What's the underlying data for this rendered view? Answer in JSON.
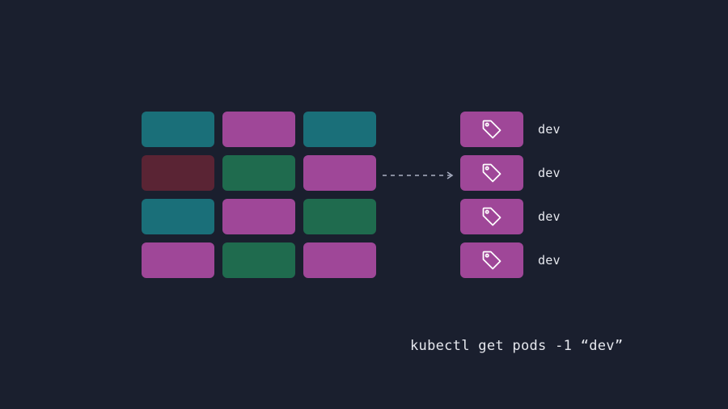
{
  "grid": {
    "cols": 3,
    "rows": 4,
    "colors": [
      [
        "teal",
        "magenta",
        "teal"
      ],
      [
        "maroon",
        "green",
        "magenta"
      ],
      [
        "teal",
        "magenta",
        "green"
      ],
      [
        "magenta",
        "green",
        "magenta"
      ]
    ]
  },
  "palette": {
    "teal": "#1a6f79",
    "magenta": "#9f4798",
    "maroon": "#5a2434",
    "green": "#1f6b4e",
    "bg": "#1a1f2e",
    "text": "#e6e8ee"
  },
  "results": [
    {
      "label": "dev"
    },
    {
      "label": "dev"
    },
    {
      "label": "dev"
    },
    {
      "label": "dev"
    }
  ],
  "command": "kubectl get pods -1 “dev”"
}
